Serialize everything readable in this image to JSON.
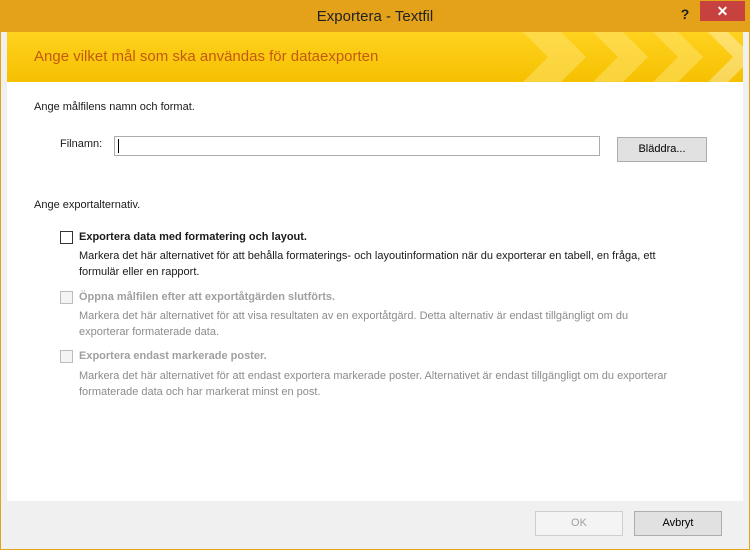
{
  "window": {
    "title": "Exportera - Textfil",
    "help_glyph": "?",
    "close_glyph": "✕"
  },
  "banner": {
    "title": "Ange vilket mål som ska användas för dataexporten"
  },
  "file_section": {
    "heading": "Ange målfilens namn och format.",
    "filename_label": "Filnamn:",
    "filename_value": "",
    "browse_label": "Bläddra..."
  },
  "options_section": {
    "heading": "Ange exportalternativ.",
    "options": [
      {
        "title": "Exportera data med formatering och layout.",
        "description_line1": "Markera det här alternativet för att behålla formaterings- och layoutinformation när du exporterar en tabell, en fråga, ett",
        "description_line2": "formulär eller en rapport.",
        "checked": false,
        "enabled": true
      },
      {
        "title": "Öppna målfilen efter att exportåtgärden slutförts.",
        "description_line1": "Markera det här alternativet för att visa resultaten av en exportåtgärd. Detta alternativ är endast tillgängligt om du",
        "description_line2": "exporterar formaterade data.",
        "checked": false,
        "enabled": false
      },
      {
        "title": "Exportera endast markerade poster.",
        "description_line1": "Markera det här alternativet för att endast exportera markerade poster. Alternativet är endast tillgängligt om du exporterar",
        "description_line2": "formaterade data och har markerat minst en post.",
        "checked": false,
        "enabled": false
      }
    ]
  },
  "footer": {
    "ok_label": "OK",
    "cancel_label": "Avbryt"
  },
  "colors": {
    "accent": "#e3a21a",
    "banner": "#ffd21f",
    "banner_text": "#c35b0e",
    "close": "#c7413e"
  }
}
